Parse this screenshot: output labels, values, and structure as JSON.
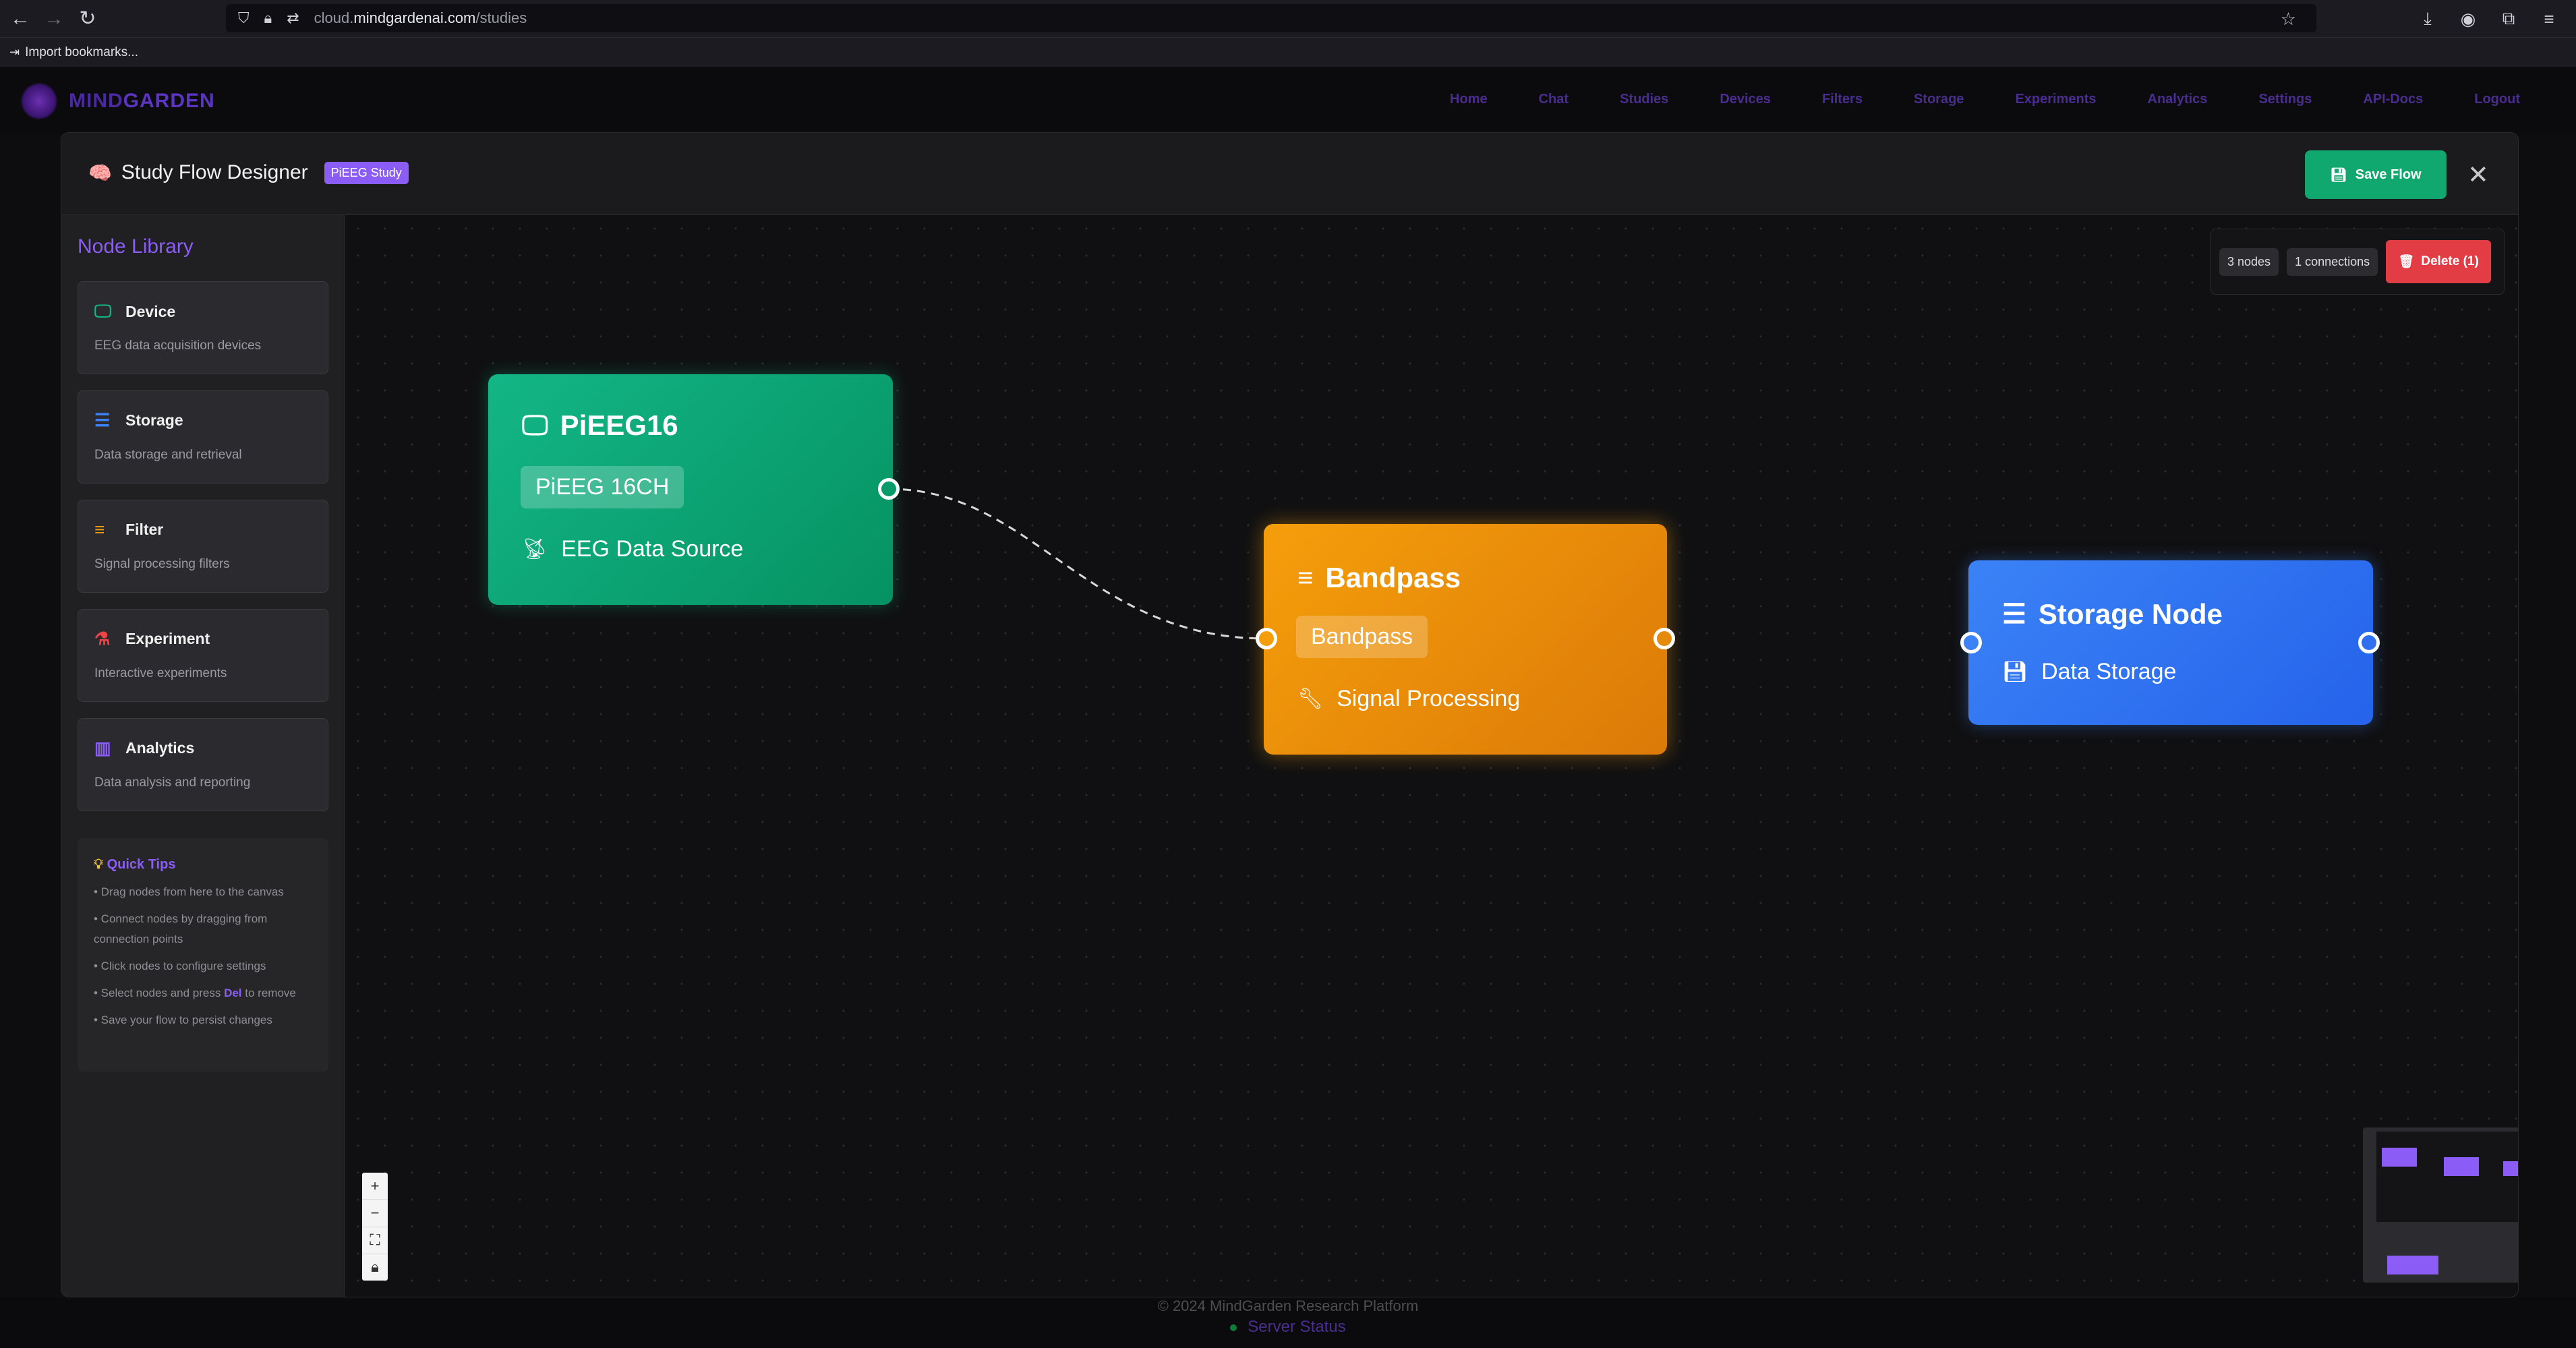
{
  "browser": {
    "url_prefix": "cloud.",
    "url_domain": "mindgardenai.com",
    "url_path": "/studies",
    "bookmarks_label": "Import bookmarks..."
  },
  "header": {
    "logo_part1": "MIND",
    "logo_part2": "GARDEN",
    "nav": [
      "Home",
      "Chat",
      "Studies",
      "Devices",
      "Filters",
      "Storage",
      "Experiments",
      "Analytics",
      "Settings",
      "API-Docs",
      "Logout"
    ]
  },
  "modal": {
    "title": "Study Flow Designer",
    "study_badge": "PiEEG Study",
    "save_label": "Save Flow",
    "close_glyph": "✕"
  },
  "library": {
    "title": "Node Library",
    "items": [
      {
        "name": "Device",
        "desc": "EEG data acquisition devices",
        "icon": "devices-icon",
        "color": "#10b981"
      },
      {
        "name": "Storage",
        "desc": "Data storage and retrieval",
        "icon": "storage-icon",
        "color": "#3b82f6"
      },
      {
        "name": "Filter",
        "desc": "Signal processing filters",
        "icon": "filter-icon",
        "color": "#f59e0b"
      },
      {
        "name": "Experiment",
        "desc": "Interactive experiments",
        "icon": "flask-icon",
        "color": "#ef4444"
      },
      {
        "name": "Analytics",
        "desc": "Data analysis and reporting",
        "icon": "chart-icon",
        "color": "#8b5cf6"
      }
    ]
  },
  "tips": {
    "title": "Quick Tips",
    "items": [
      "• Drag nodes from here to the canvas",
      "• Connect nodes by dragging from connection points",
      "• Click nodes to configure settings",
      "• Save your flow to persist changes"
    ],
    "delete_tip_before": "• Select nodes and press ",
    "delete_tip_key": "Del",
    "delete_tip_after": " to remove"
  },
  "stats": {
    "nodes": "3 nodes",
    "connections": "1 connections",
    "delete_label": "Delete (1)"
  },
  "nodes": {
    "device": {
      "title": "PiEEG16",
      "tag": "PiEEG 16CH",
      "subtitle": "EEG Data Source"
    },
    "filter": {
      "title": "Bandpass",
      "tag": "Bandpass",
      "subtitle": "Signal Processing"
    },
    "storage": {
      "title": "Storage Node",
      "subtitle": "Data Storage"
    }
  },
  "footer": {
    "copyright": "© 2024 MindGarden Research Platform",
    "server_status": "Server Status"
  },
  "colors": {
    "accent": "#8b5cf6",
    "device": "#10b981",
    "filter": "#f59e0b",
    "storage": "#3b82f6",
    "danger": "#ef4444",
    "save": "#10a86e"
  }
}
